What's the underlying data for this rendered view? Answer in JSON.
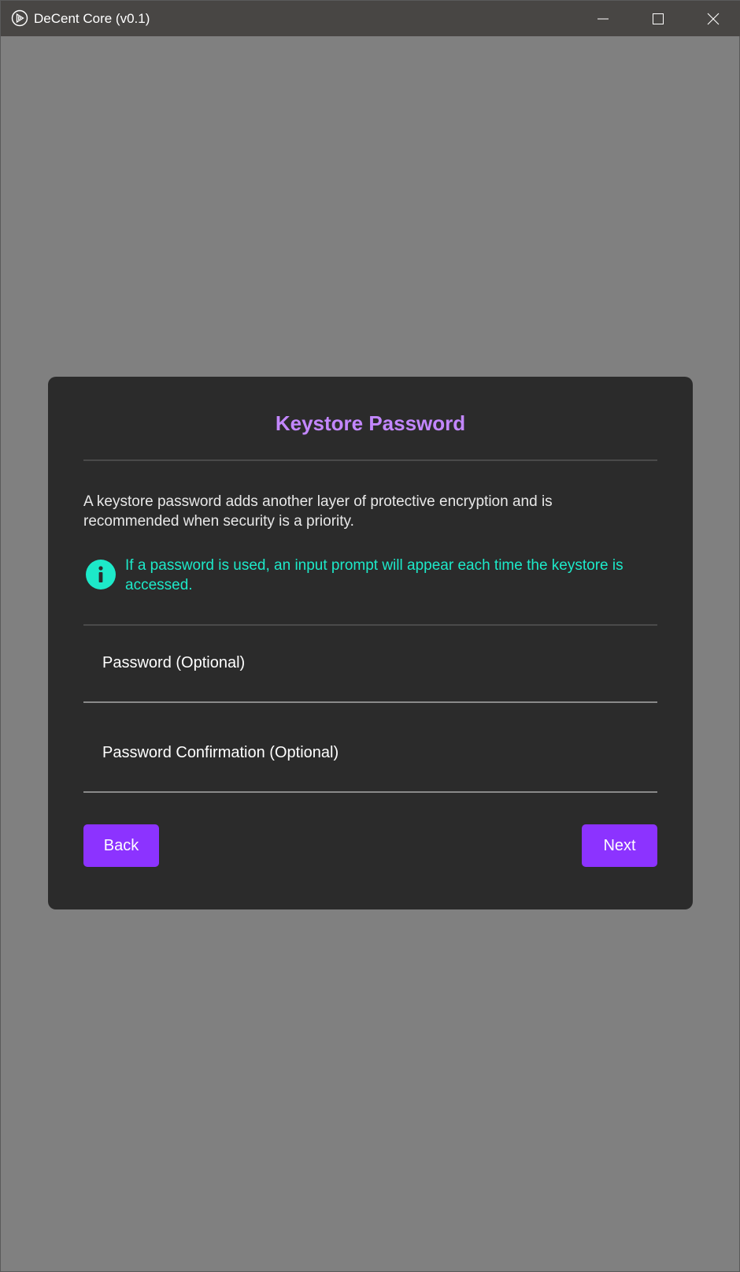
{
  "window": {
    "title": "DeCent Core (v0.1)",
    "controls": [
      "minimize-icon",
      "maximize-icon",
      "close-icon"
    ]
  },
  "dialog": {
    "title": "Keystore Password",
    "description": "A keystore password adds another layer of protective encryption and is recommended when security is a priority.",
    "info": "If a password is used, an input prompt will appear each time the keystore is accessed.",
    "fields": [
      {
        "label": "Password (Optional)",
        "value": ""
      },
      {
        "label": "Password Confirmation (Optional)",
        "value": ""
      }
    ],
    "back_label": "Back",
    "next_label": "Next"
  },
  "colors": {
    "background": "#808080",
    "titlebar": "#484644",
    "dialog": "#2b2b2b",
    "title_accent": "#c387ff",
    "info_accent": "#1de9c9",
    "button": "#8c33ff"
  }
}
